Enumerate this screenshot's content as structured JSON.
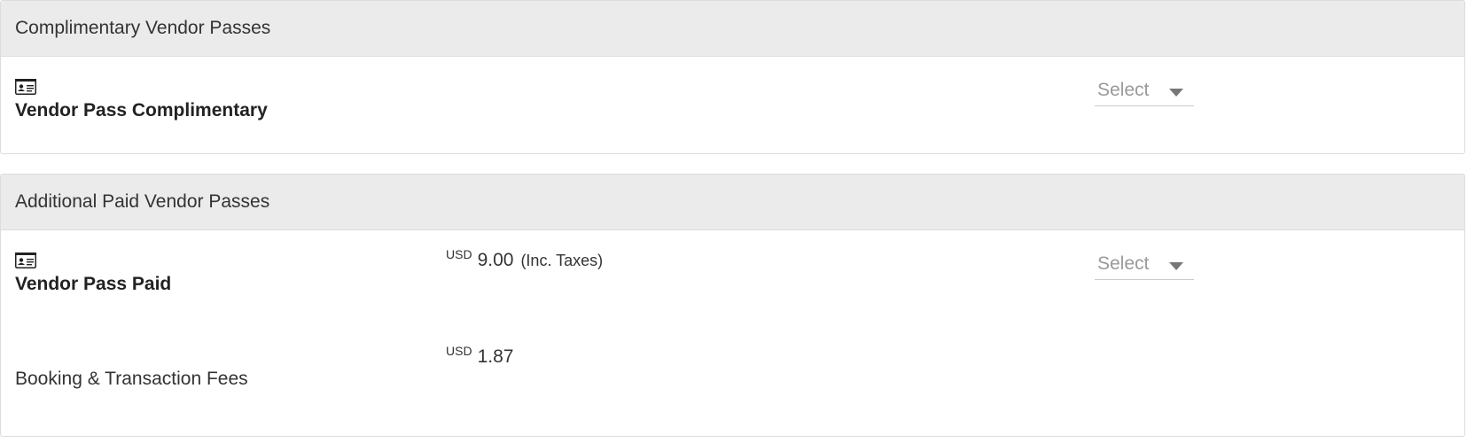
{
  "sections": [
    {
      "title": "Complimentary Vendor Passes",
      "items": [
        {
          "icon": "id-card-icon",
          "name": "Vendor Pass Complimentary",
          "select": {
            "label": "Select"
          }
        }
      ]
    },
    {
      "title": "Additional Paid Vendor Passes",
      "items": [
        {
          "icon": "id-card-icon",
          "name": "Vendor Pass Paid",
          "currency": "USD",
          "price": "9.00",
          "tax_note": "(Inc. Taxes)",
          "select": {
            "label": "Select"
          }
        }
      ],
      "fees": {
        "label": "Booking & Transaction Fees",
        "currency": "USD",
        "amount": "1.87"
      }
    }
  ]
}
